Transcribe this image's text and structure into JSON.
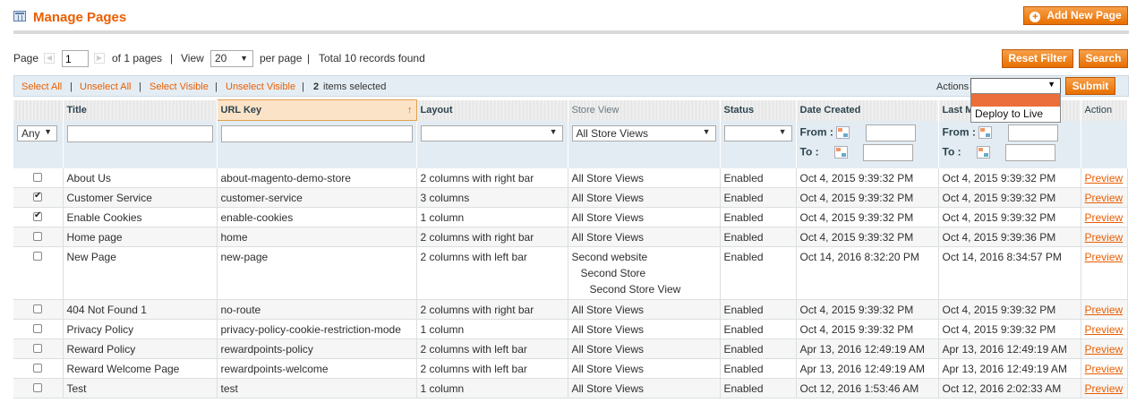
{
  "header": {
    "title": "Manage Pages",
    "add_button": "Add New Page"
  },
  "pager": {
    "page_label": "Page",
    "page_value": "1",
    "of_pages": "of 1 pages",
    "view_label": "View",
    "view_value": "20",
    "per_page": "per page",
    "total": "Total 10 records found",
    "sep": "|"
  },
  "filter_buttons": {
    "reset": "Reset Filter",
    "search": "Search"
  },
  "massaction": {
    "select_all": "Select All",
    "unselect_all": "Unselect All",
    "select_visible": "Select Visible",
    "unselect_visible": "Unselect Visible",
    "selected_count": "2",
    "selected_text": "items selected",
    "actions_label": "Actions",
    "submit": "Submit",
    "dropdown_options": [
      "",
      "Deploy to Live"
    ]
  },
  "columns": [
    "Title",
    "URL Key",
    "Layout",
    "Store View",
    "Status",
    "Date Created",
    "Last Modified",
    "Action"
  ],
  "filters": {
    "any": "Any",
    "store_view": "All Store Views",
    "from": "From :",
    "to": "To :"
  },
  "rows": [
    {
      "checked": false,
      "title": "About Us",
      "url": "about-magento-demo-store",
      "layout": "2 columns with right bar",
      "store": [
        "All Store Views"
      ],
      "status": "Enabled",
      "created": "Oct 4, 2015 9:39:32 PM",
      "modified": "Oct 4, 2015 9:39:32 PM",
      "action": "Preview"
    },
    {
      "checked": true,
      "title": "Customer Service",
      "url": "customer-service",
      "layout": "3 columns",
      "store": [
        "All Store Views"
      ],
      "status": "Enabled",
      "created": "Oct 4, 2015 9:39:32 PM",
      "modified": "Oct 4, 2015 9:39:32 PM",
      "action": "Preview"
    },
    {
      "checked": true,
      "title": "Enable Cookies",
      "url": "enable-cookies",
      "layout": "1 column",
      "store": [
        "All Store Views"
      ],
      "status": "Enabled",
      "created": "Oct 4, 2015 9:39:32 PM",
      "modified": "Oct 4, 2015 9:39:32 PM",
      "action": "Preview"
    },
    {
      "checked": false,
      "title": "Home page",
      "url": "home",
      "layout": "2 columns with right bar",
      "store": [
        "All Store Views"
      ],
      "status": "Enabled",
      "created": "Oct 4, 2015 9:39:32 PM",
      "modified": "Oct 4, 2015 9:39:36 PM",
      "action": "Preview"
    },
    {
      "checked": false,
      "title": "New Page",
      "url": "new-page",
      "layout": "2 columns with left bar",
      "store": [
        "Second website",
        "Second Store",
        "Second Store View"
      ],
      "status": "Enabled",
      "created": "Oct 14, 2016 8:32:20 PM",
      "modified": "Oct 14, 2016 8:34:57 PM",
      "action": "Preview"
    },
    {
      "checked": false,
      "title": "404 Not Found 1",
      "url": "no-route",
      "layout": "2 columns with right bar",
      "store": [
        "All Store Views"
      ],
      "status": "Enabled",
      "created": "Oct 4, 2015 9:39:32 PM",
      "modified": "Oct 4, 2015 9:39:32 PM",
      "action": "Preview"
    },
    {
      "checked": false,
      "title": "Privacy Policy",
      "url": "privacy-policy-cookie-restriction-mode",
      "layout": "1 column",
      "store": [
        "All Store Views"
      ],
      "status": "Enabled",
      "created": "Oct 4, 2015 9:39:32 PM",
      "modified": "Oct 4, 2015 9:39:32 PM",
      "action": "Preview"
    },
    {
      "checked": false,
      "title": "Reward Policy",
      "url": "rewardpoints-policy",
      "layout": "2 columns with left bar",
      "store": [
        "All Store Views"
      ],
      "status": "Enabled",
      "created": "Apr 13, 2016 12:49:19 AM",
      "modified": "Apr 13, 2016 12:49:19 AM",
      "action": "Preview"
    },
    {
      "checked": false,
      "title": "Reward Welcome Page",
      "url": "rewardpoints-welcome",
      "layout": "2 columns with left bar",
      "store": [
        "All Store Views"
      ],
      "status": "Enabled",
      "created": "Apr 13, 2016 12:49:19 AM",
      "modified": "Apr 13, 2016 12:49:19 AM",
      "action": "Preview"
    },
    {
      "checked": false,
      "title": "Test",
      "url": "test",
      "layout": "1 column",
      "store": [
        "All Store Views"
      ],
      "status": "Enabled",
      "created": "Oct 12, 2016 1:53:46 AM",
      "modified": "Oct 12, 2016 2:02:33 AM",
      "action": "Preview"
    }
  ],
  "colors": {
    "accent": "#eb5e00",
    "button": "#f18200"
  }
}
